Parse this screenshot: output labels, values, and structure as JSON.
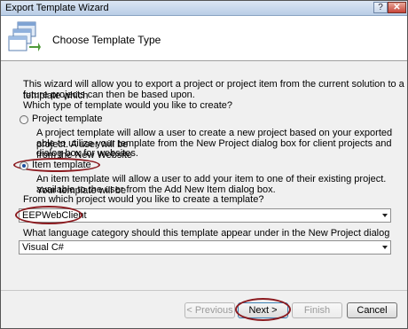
{
  "window": {
    "title": "Export Template Wizard",
    "help_glyph": "?",
    "close_glyph": "✕"
  },
  "header": {
    "title": "Choose Template Type",
    "icon": "export-template-wizard-icon"
  },
  "intro": {
    "line1": "This wizard will allow you to export a project or project item from the current solution to a template which",
    "line2": "future projects can then be based upon."
  },
  "type_question": "Which type of template would you like to create?",
  "options": {
    "project": {
      "label": "Project template",
      "selected": false,
      "desc1": "A project template will allow a user to create a new project based on your exported project. A user will be",
      "desc2": "able to utilize your template from the New Project dialog box for client projects and from the New Website",
      "desc3": "dialog box for websites."
    },
    "item": {
      "label": "Item template",
      "selected": true,
      "desc1": "An item template will allow a user to add your item to one of their existing project. Your template will be",
      "desc2": "available to the user from the Add New Item dialog box."
    }
  },
  "project_question": "From which project would you like to create a template?",
  "project_select": {
    "value": "EEPWebClient"
  },
  "language_question": "What language category should this template appear under in the New Project dialog box?",
  "language_select": {
    "value": "Visual C#"
  },
  "buttons": {
    "previous": "< Previous",
    "next": "Next >",
    "finish": "Finish",
    "cancel": "Cancel"
  },
  "colors": {
    "highlight_ring": "#8b1a1f",
    "header_bg": "#ffffff",
    "dialog_bg": "#f0f0f0"
  }
}
